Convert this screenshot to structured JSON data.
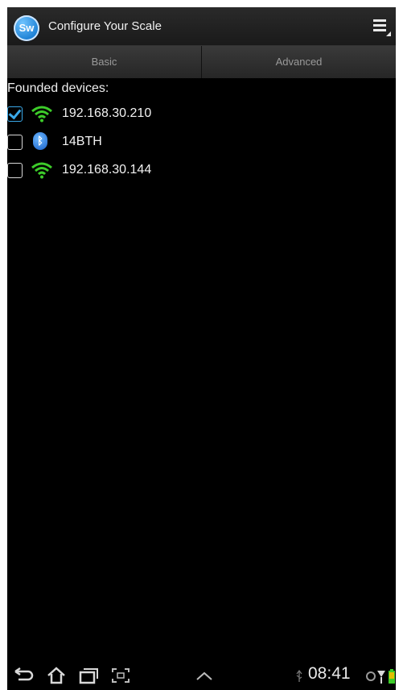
{
  "app": {
    "logo_text": "Sw",
    "title": "Configure Your Scale",
    "menu_icon": "overflow-menu-icon"
  },
  "tabs": [
    {
      "label": "Basic",
      "selected": true
    },
    {
      "label": "Advanced",
      "selected": false
    }
  ],
  "devices_section": {
    "label": "Founded devices:",
    "items": [
      {
        "name": "192.168.30.210",
        "type": "wifi",
        "checked": true
      },
      {
        "name": "14BTH",
        "type": "bluetooth",
        "checked": false
      },
      {
        "name": "192.168.30.144",
        "type": "wifi",
        "checked": false
      }
    ]
  },
  "system_bar": {
    "time": "08:41",
    "icons": [
      "back-icon",
      "home-icon",
      "recent-apps-icon",
      "screenshot-icon",
      "up-chevron-icon",
      "usb-icon",
      "wifi-status-icon",
      "battery-icon"
    ]
  },
  "colors": {
    "wifi": "#3dcc2a",
    "accent": "#3aa8e8",
    "background": "#000000"
  }
}
